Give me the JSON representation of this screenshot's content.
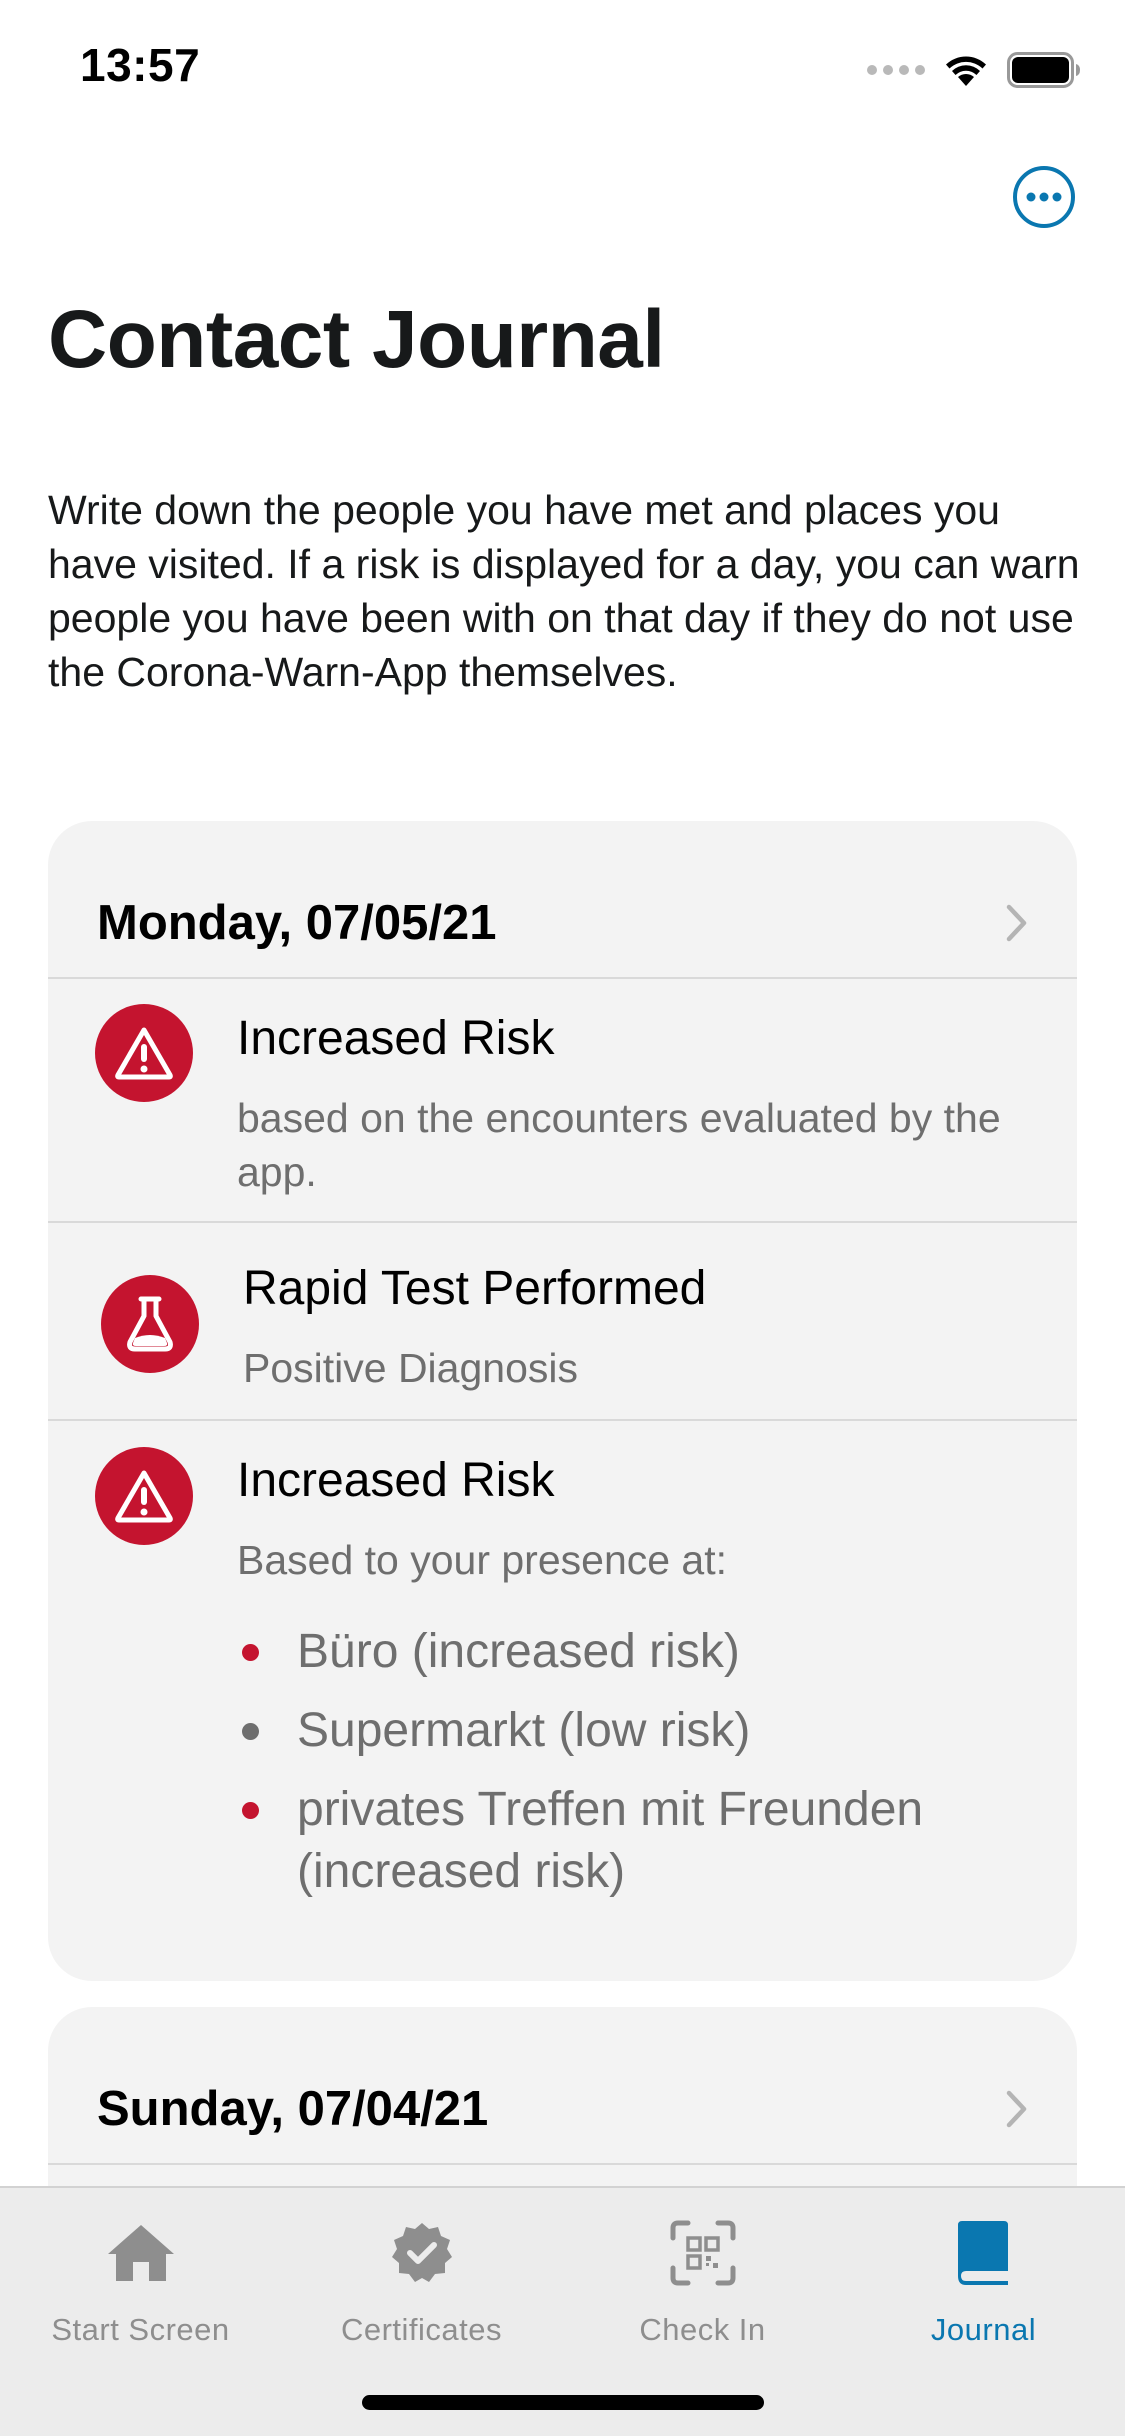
{
  "status_bar": {
    "time": "13:57"
  },
  "header": {
    "title": "Contact Journal",
    "more_icon": "ellipsis-circle-icon"
  },
  "intro": "Write down the people you have met and places you have visited. If a risk is displayed for a day, you can warn people you have been with on that day if they do not use the Corona-Warn-App themselves.",
  "days": [
    {
      "date": "Monday, 07/05/21",
      "entries": [
        {
          "icon": "warning-icon",
          "title": "Increased Risk",
          "subtitle": "based on the encounters evaluated by the app."
        },
        {
          "icon": "test-flask-icon",
          "title": "Rapid Test Performed",
          "subtitle": "Positive Diagnosis"
        },
        {
          "icon": "warning-icon",
          "title": "Increased Risk",
          "subtitle": "Based to your presence at:",
          "locations": [
            {
              "label": "Büro (increased risk)",
              "color": "#c4142f"
            },
            {
              "label": "Supermarkt (low risk)",
              "color": "#6e6e6e"
            },
            {
              "label": "privates Treffen mit Freunden (increased risk)",
              "color": "#c4142f"
            }
          ]
        }
      ]
    },
    {
      "date": "Sunday, 07/04/21"
    }
  ],
  "tabs": [
    {
      "label": "Start Screen",
      "icon": "house-icon",
      "active": false
    },
    {
      "label": "Certificates",
      "icon": "certificate-badge-icon",
      "active": false
    },
    {
      "label": "Check In",
      "icon": "qr-scan-icon",
      "active": false
    },
    {
      "label": "Journal",
      "icon": "book-icon",
      "active": true
    }
  ],
  "colors": {
    "accent": "#0a77b0",
    "risk_red": "#c4142f",
    "card_bg": "#f3f3f3",
    "secondary_text": "#6e6e6e"
  }
}
